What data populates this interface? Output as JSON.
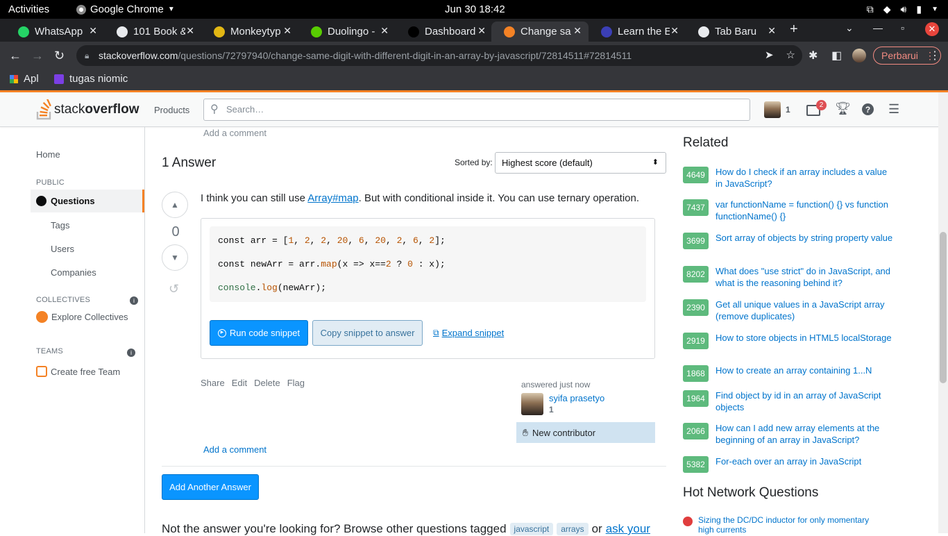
{
  "os": {
    "activities": "Activities",
    "app": "Google Chrome",
    "clock": "Jun 30  18:42"
  },
  "tabs": [
    {
      "title": "WhatsApp",
      "icon": "whatsapp-icon",
      "color": "#25d366"
    },
    {
      "title": "101 Book &",
      "icon": "globe-icon",
      "color": "#e8eaed"
    },
    {
      "title": "Monkeytyp",
      "icon": "monkeytype-icon",
      "color": "#e2b714"
    },
    {
      "title": "Duolingo -",
      "icon": "duolingo-icon",
      "color": "#58cc02"
    },
    {
      "title": "Dashboard",
      "icon": "dashboard-icon",
      "color": "#000000"
    },
    {
      "title": "Change sa",
      "icon": "stackoverflow-icon",
      "color": "#f48225"
    },
    {
      "title": "Learn the E",
      "icon": "learn-icon",
      "color": "#3b3fb6"
    },
    {
      "title": "Tab Baru",
      "icon": "chrome-icon",
      "color": "#e8eaed"
    }
  ],
  "omnibox": {
    "host": "stackoverflow.com",
    "path": "/questions/72797940/change-same-digit-with-different-digit-in-an-array-by-javascript/72814511#72814511"
  },
  "update_label": "Perbarui",
  "bookmarks": [
    {
      "label": "Apl"
    },
    {
      "label": "tugas niomic"
    }
  ],
  "so": {
    "logo_a": "stack",
    "logo_b": "overflow",
    "products": "Products",
    "search_placeholder": "Search…",
    "reputation": "1",
    "inbox_count": "2"
  },
  "leftnav": {
    "home": "Home",
    "public": "PUBLIC",
    "questions": "Questions",
    "tags": "Tags",
    "users": "Users",
    "companies": "Companies",
    "collectives": "COLLECTIVES",
    "explore": "Explore Collectives",
    "teams": "TEAMS",
    "create_team": "Create free Team"
  },
  "main": {
    "add_comment_top": "Add a comment",
    "answers_count": "1 Answer",
    "sorted_by": "Sorted by:",
    "sort_value": "Highest score (default)",
    "vote_count": "0",
    "answer_pre": "I think you can still use ",
    "answer_link": "Array#map",
    "answer_post": ". But with conditional inside it. You can use ternary operation.",
    "run": "Run code snippet",
    "copy": "Copy snippet to answer",
    "expand": "Expand snippet",
    "menu": [
      "Share",
      "Edit",
      "Delete",
      "Flag"
    ],
    "answered": "answered just now",
    "user_name": "syifa prasetyo",
    "user_rep": "1",
    "new_contributor": "New contributor",
    "add_comment": "Add a comment",
    "add_another": "Add Another Answer",
    "not_answer": "Not the answer you're looking for? Browse other questions tagged",
    "tag1": "javascript",
    "tag2": "arrays",
    "or": "or",
    "ask": "ask your"
  },
  "related_title": "Related",
  "related": [
    {
      "score": "4649",
      "title": "How do I check if an array includes a value in JavaScript?"
    },
    {
      "score": "7437",
      "title": "var functionName = function() {} vs function functionName() {}"
    },
    {
      "score": "3699",
      "title": "Sort array of objects by string property value"
    },
    {
      "score": "8202",
      "title": "What does \"use strict\" do in JavaScript, and what is the reasoning behind it?"
    },
    {
      "score": "2390",
      "title": "Get all unique values in a JavaScript array (remove duplicates)"
    },
    {
      "score": "2919",
      "title": "How to store objects in HTML5 localStorage"
    },
    {
      "score": "1868",
      "title": "How to create an array containing 1...N"
    },
    {
      "score": "1964",
      "title": "Find object by id in an array of JavaScript objects"
    },
    {
      "score": "2066",
      "title": "How can I add new array elements at the beginning of an array in JavaScript?"
    },
    {
      "score": "5382",
      "title": "For-each over an array in JavaScript"
    }
  ],
  "hot_title": "Hot Network Questions",
  "hot_q": "Sizing the DC/DC inductor for only momentary high currents"
}
